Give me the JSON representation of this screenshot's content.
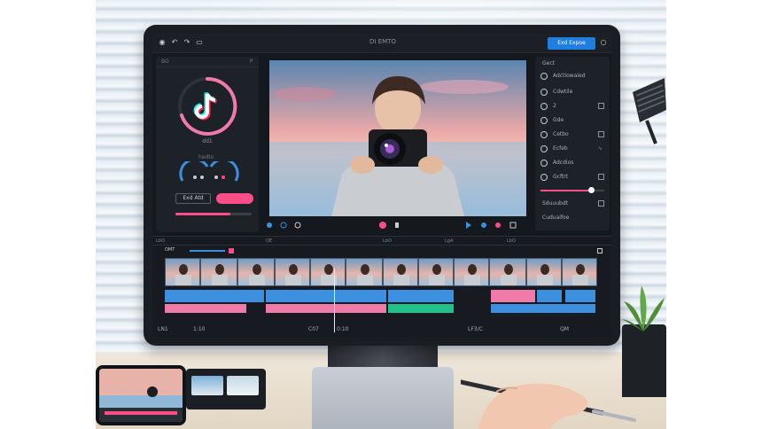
{
  "topbar": {
    "title": "DI EMTO",
    "export_label": "Exd Expoe"
  },
  "left_panel": {
    "tabs": [
      "BO",
      "P"
    ],
    "caption": "dd1",
    "knob_label": "hedto",
    "dark_button_label": "Exd Atd"
  },
  "right_panel": {
    "header": "Gect",
    "rows": [
      {
        "icon": "settings-icon",
        "label": "Adctiowaied"
      },
      {
        "icon": "sliders-icon",
        "label": "Cdwtile"
      },
      {
        "icon": "circle-icon",
        "label": "2"
      },
      {
        "icon": "circle-icon",
        "label": "Gde"
      },
      {
        "icon": "camera-icon",
        "label": "Cetbo"
      },
      {
        "icon": "link-icon",
        "label": "Ecfeb"
      },
      {
        "icon": "waveform-icon",
        "label": "Adcdios"
      },
      {
        "icon": "star-icon",
        "label": "Gcftrt"
      },
      {
        "icon": "grid-icon",
        "label": "Sduuubdt"
      },
      {
        "icon": "plus-icon",
        "label": "Cuduaifoe"
      }
    ],
    "slider_level": 0.78
  },
  "timeline": {
    "header_label": "OMT",
    "ruler_marks": [
      "LbO",
      "OE",
      "LbO",
      "LgA",
      "LbO"
    ],
    "footer": {
      "left": "LN1",
      "left_time": "1:10",
      "mid": "C07",
      "mid_time": "0:10",
      "right": "LF3/C",
      "far_right": "QM"
    },
    "playhead_position": 0.39
  },
  "colors": {
    "accent_blue": "#1f7fe0",
    "accent_pink": "#ff4d88",
    "audio_pink": "#f07aa8",
    "audio_teal": "#21c28a",
    "audio_blue": "#3d8fe0",
    "logo_cyan": "#25f4ee",
    "logo_red": "#fe2c55"
  }
}
